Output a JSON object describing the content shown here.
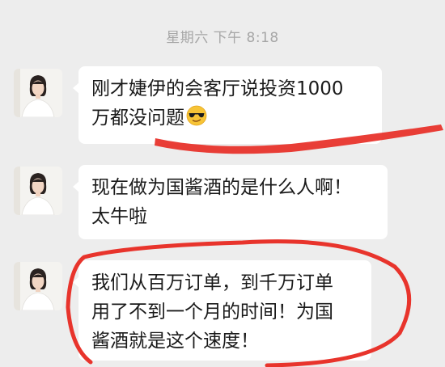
{
  "chat": {
    "timestamp": "星期六 下午 8:18",
    "messages": [
      {
        "lines": [
          "刚才婕伊的会客厅说投资1000",
          "万都没问题"
        ],
        "emoji": "sunglasses-emoji"
      },
      {
        "lines": [
          "现在做为国酱酒的是什么人啊！",
          "太牛啦"
        ]
      },
      {
        "lines": [
          "我们从百万订单，到千万订单",
          "用了不到一个月的时间！为国",
          "酱酒就是这个速度！"
        ]
      }
    ]
  },
  "colors": {
    "background": "#ededed",
    "bubble": "#ffffff",
    "annotation": "#e8342c",
    "timestamp": "#a6a6a6"
  }
}
